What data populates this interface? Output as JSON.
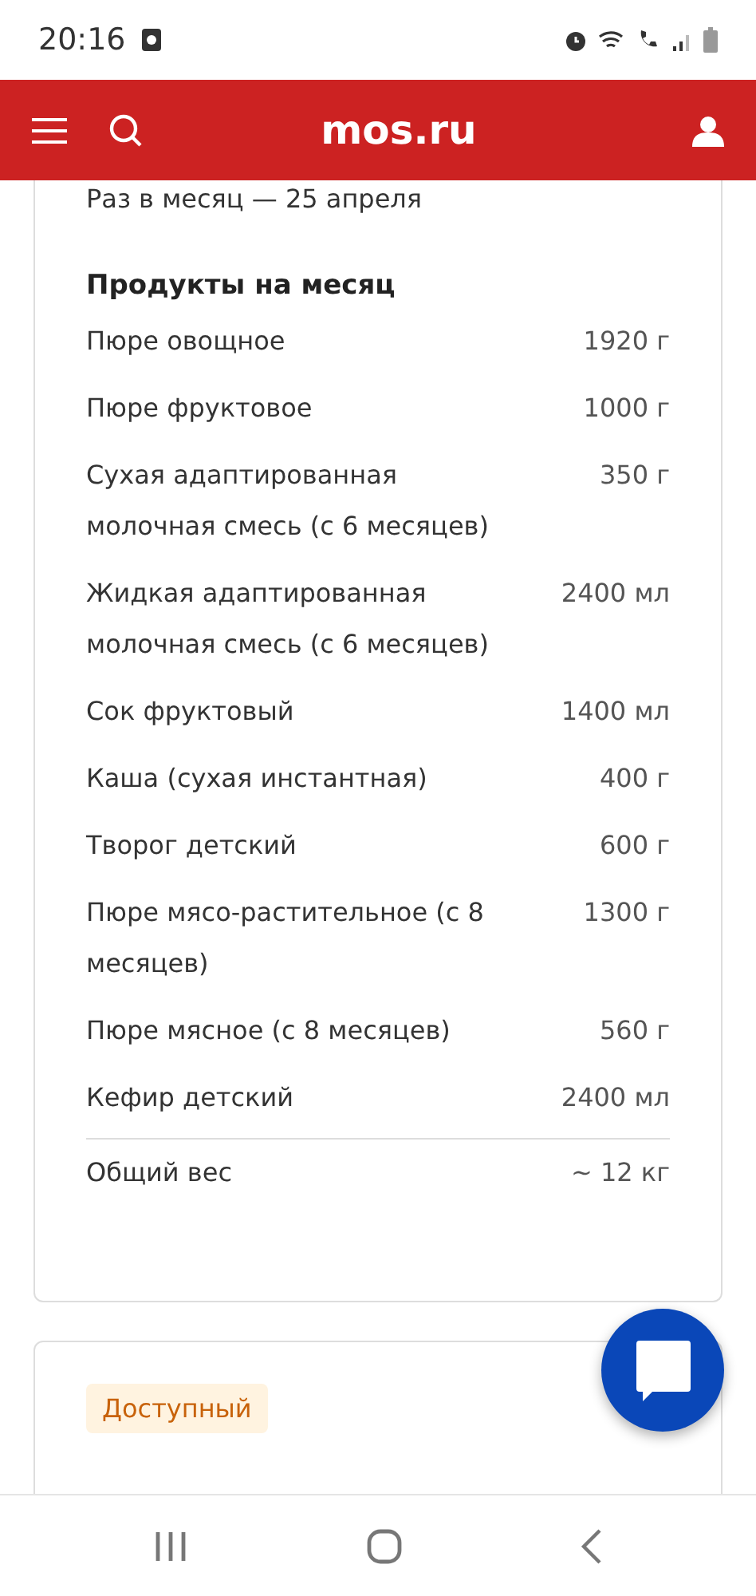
{
  "status_bar": {
    "time": "20:16"
  },
  "header": {
    "title": "mos.ru"
  },
  "card": {
    "schedule": "Раз в месяц — 25 апреля",
    "heading": "Продукты на месяц",
    "items": [
      {
        "name": "Пюре овощное",
        "amount": "1920 г"
      },
      {
        "name": "Пюре фруктовое",
        "amount": "1000 г"
      },
      {
        "name": "Сухая адаптированная молочная смесь (с 6 месяцев)",
        "amount": "350 г"
      },
      {
        "name": "Жидкая адаптированная молочная смесь (с 6 месяцев)",
        "amount": "2400 мл"
      },
      {
        "name": "Сок фруктовый",
        "amount": "1400 мл"
      },
      {
        "name": "Каша (сухая инстантная)",
        "amount": "400 г"
      },
      {
        "name": "Творог детский",
        "amount": "600 г"
      },
      {
        "name": "Пюре мясо-растительное (с 8 месяцев)",
        "amount": "1300 г"
      },
      {
        "name": "Пюре мясное (с 8 месяцев)",
        "amount": "560 г"
      },
      {
        "name": "Кефир детский",
        "amount": "2400 мл"
      }
    ],
    "total": {
      "name": "Общий вес",
      "amount": "~ 12 кг"
    }
  },
  "next_card": {
    "badge": "Доступный"
  }
}
